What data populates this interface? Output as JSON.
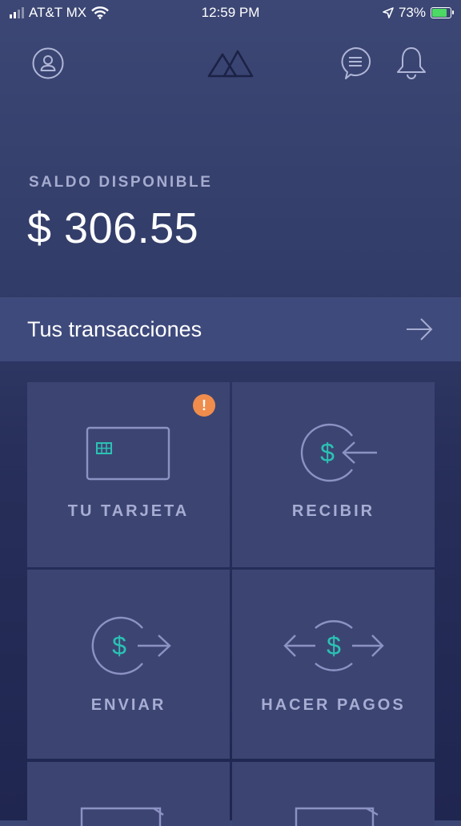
{
  "status_bar": {
    "carrier": "AT&T MX",
    "time": "12:59 PM",
    "battery": "73%",
    "battery_level": 0.73
  },
  "header": {
    "profile_icon": "user-circle-icon",
    "logo_icon": "mountains-logo",
    "chat_icon": "chat-bubble-icon",
    "bell_icon": "bell-icon"
  },
  "balance": {
    "label": "SALDO DISPONIBLE",
    "amount": "$ 306.55"
  },
  "transactions": {
    "label": "Tus transacciones"
  },
  "tiles": {
    "card": {
      "label": "TU TARJETA",
      "badge": "!"
    },
    "receive": {
      "label": "RECIBIR",
      "symbol": "$"
    },
    "send": {
      "label": "ENVIAR",
      "symbol": "$"
    },
    "pay": {
      "label": "HACER PAGOS",
      "symbol": "$"
    }
  },
  "colors": {
    "accent": "#2bc2b4",
    "icon_stroke": "#8c93c4",
    "badge": "#f08c4c"
  }
}
